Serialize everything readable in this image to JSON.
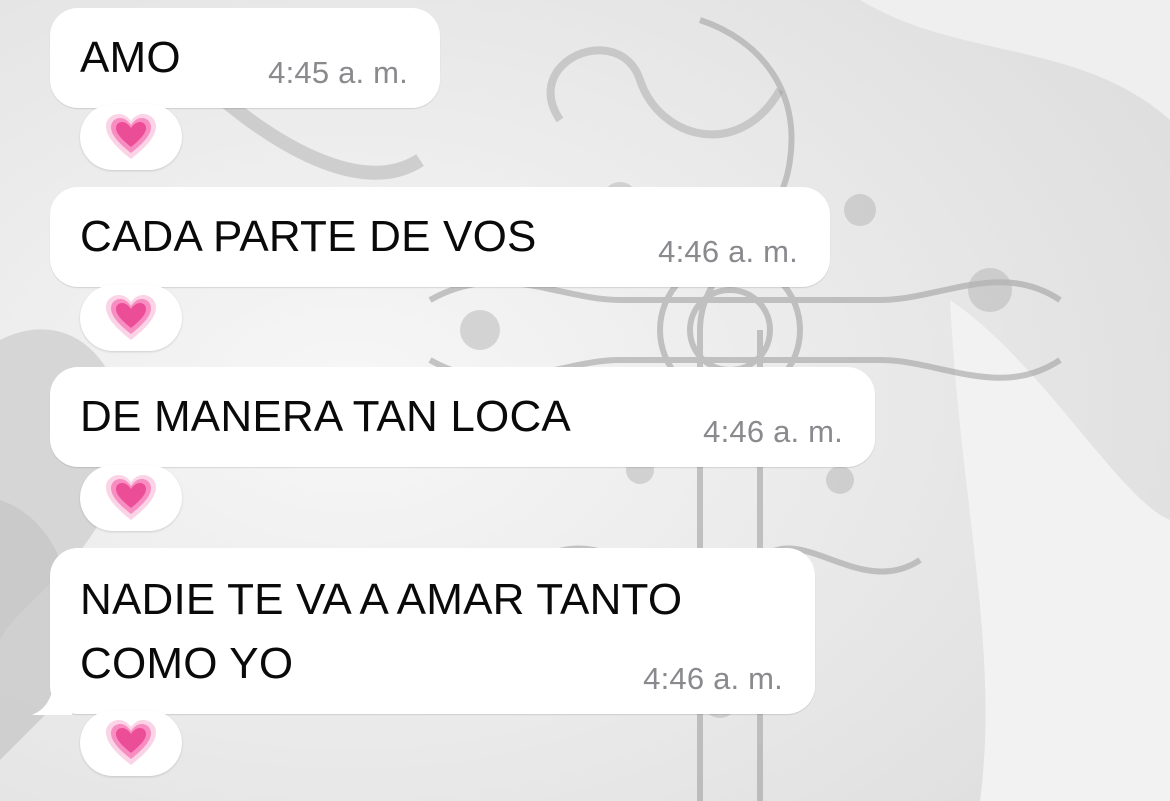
{
  "messages": [
    {
      "text": "AMO",
      "time": "4:45 a. m.",
      "reaction": "growing-heart-icon"
    },
    {
      "text": "CADA PARTE DE VOS",
      "time": "4:46 a. m.",
      "reaction": "growing-heart-icon"
    },
    {
      "text": "DE MANERA TAN LOCA",
      "time": "4:46 a. m.",
      "reaction": "growing-heart-icon"
    },
    {
      "text": "NADIE TE VA A AMAR TANTO\nCOMO YO",
      "time": "4:46 a. m.",
      "reaction": "growing-heart-icon"
    }
  ],
  "colors": {
    "bubble": "#ffffff",
    "text": "#0a0a0a",
    "timestamp": "#8a8a8e",
    "wallpaper": "#e9e9e9",
    "heart": "#f25fa8"
  }
}
